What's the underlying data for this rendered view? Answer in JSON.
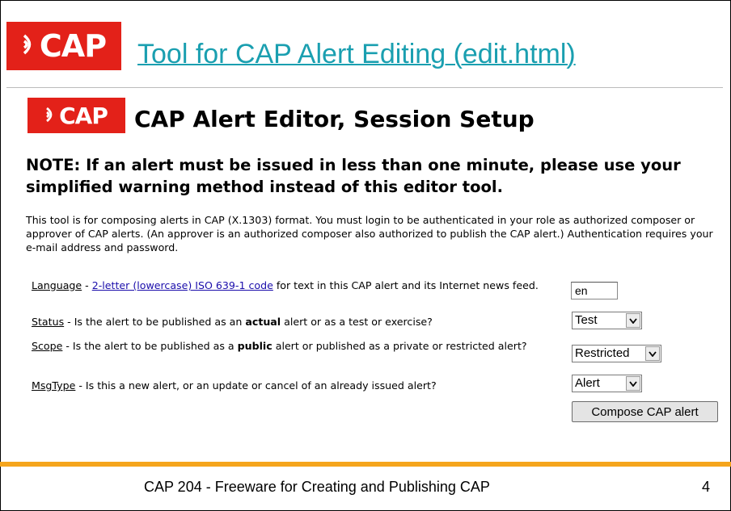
{
  "slide": {
    "logo_text": "CAP",
    "title": "Tool for CAP Alert Editing (edit.html)",
    "footer": "CAP 204 - Freeware for Creating and Publishing CAP",
    "page_number": "4"
  },
  "editor": {
    "logo_text": "CAP",
    "title": "CAP Alert Editor, Session Setup",
    "note": "NOTE: If an alert must be issued in less than one minute, please use your simplified warning method instead of this editor tool.",
    "intro": "This tool is for composing alerts in CAP (X.1303) format. You must login to be authenticated in your role as authorized composer or approver of CAP alerts. (An approver is an authorized composer also authorized to publish the CAP alert.) Authentication requires your e-mail address and password."
  },
  "fields": {
    "language": {
      "label": "Language",
      "sep": " - ",
      "link_text": "2-letter (lowercase) ISO 639-1 code",
      "desc_after": " for text in this CAP alert and its Internet news feed.",
      "value": "en"
    },
    "status": {
      "label": "Status",
      "desc_before": " - Is the alert to be published as an ",
      "emphasis": "actual",
      "desc_after": " alert or as a test or exercise?",
      "value": "Test"
    },
    "scope": {
      "label": "Scope",
      "desc_before": " - Is the alert to be published as a ",
      "emphasis": "public",
      "desc_after": " alert or published as a private or restricted alert?",
      "value": "Restricted"
    },
    "msgtype": {
      "label": "MsgType",
      "desc_after": " - Is this a new alert, or an update or cancel of an already issued alert?",
      "value": "Alert"
    }
  },
  "actions": {
    "compose_label": "Compose CAP alert"
  },
  "icons": {
    "logo_wave": "broadcast-wave-icon",
    "select_arrow": "chevron-down-icon"
  },
  "colors": {
    "logo_red": "#e32119",
    "title_teal": "#1a9fb0",
    "footer_bar_orange": "#f5a51c",
    "link_blue": "#1a0dab"
  }
}
